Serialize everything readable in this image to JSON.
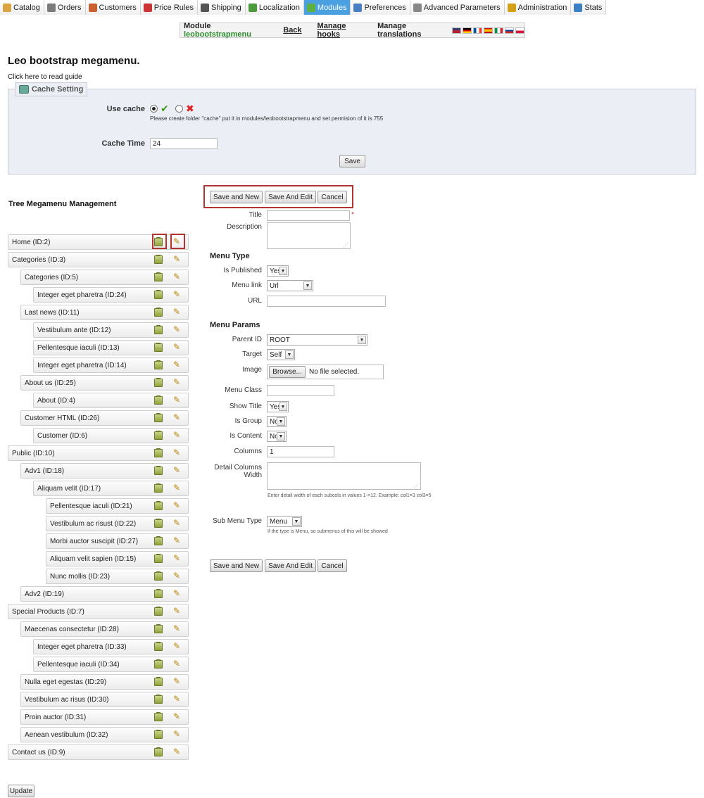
{
  "nav": {
    "tabs": [
      {
        "label": "Catalog",
        "icon": "catalog-icon",
        "color": "#d9a441"
      },
      {
        "label": "Orders",
        "icon": "cart-icon",
        "color": "#7a7a7a"
      },
      {
        "label": "Customers",
        "icon": "customers-icon",
        "color": "#c9602f"
      },
      {
        "label": "Price Rules",
        "icon": "price-rules-icon",
        "color": "#c33"
      },
      {
        "label": "Shipping",
        "icon": "truck-icon",
        "color": "#555"
      },
      {
        "label": "Localization",
        "icon": "globe-icon",
        "color": "#4a9c3b"
      },
      {
        "label": "Modules",
        "icon": "puzzle-icon",
        "color": "#5fb043"
      },
      {
        "label": "Preferences",
        "icon": "preferences-icon",
        "color": "#4a7fc1"
      },
      {
        "label": "Advanced Parameters",
        "icon": "wrench-icon",
        "color": "#888"
      },
      {
        "label": "Administration",
        "icon": "key-icon",
        "color": "#d4a017"
      },
      {
        "label": "Stats",
        "icon": "stats-icon",
        "color": "#3b7fc4"
      }
    ],
    "active": "Modules"
  },
  "module_bar": {
    "prefix": "Module",
    "name": "leobootstrapmenu",
    "back": "Back",
    "manage_hooks": "Manage hooks",
    "manage_translations": "Manage translations",
    "flags": [
      "en",
      "de",
      "fr",
      "es",
      "it",
      "ru",
      "pl"
    ]
  },
  "page": {
    "title": "Leo bootstrap megamenu.",
    "guide_link": "Click here to read guide"
  },
  "cache": {
    "legend": "Cache Setting",
    "use_cache_label": "Use cache",
    "use_cache_value": "yes",
    "note": "Please create folder \"cache\" put it in modules/leobootstrapmenu and set permision of it is 755",
    "cache_time_label": "Cache Time",
    "cache_time_value": "24",
    "save": "Save"
  },
  "tree": {
    "title": "Tree Megamenu Management",
    "update": "Update",
    "nodes": [
      {
        "label": "Home (ID:2)",
        "level": 0
      },
      {
        "label": "Categories (ID:3)",
        "level": 0
      },
      {
        "label": "Categories (ID:5)",
        "level": 1
      },
      {
        "label": "Integer eget pharetra (ID:24)",
        "level": 2
      },
      {
        "label": "Last news (ID:11)",
        "level": 1
      },
      {
        "label": "Vestibulum ante (ID:12)",
        "level": 2
      },
      {
        "label": "Pellentesque iaculi (ID:13)",
        "level": 2
      },
      {
        "label": "Integer eget pharetra (ID:14)",
        "level": 2
      },
      {
        "label": "About us (ID:25)",
        "level": 1
      },
      {
        "label": "About (ID:4)",
        "level": 2
      },
      {
        "label": "Customer HTML (ID:26)",
        "level": 1
      },
      {
        "label": "Customer (ID:6)",
        "level": 2
      },
      {
        "label": "Public (ID:10)",
        "level": 0
      },
      {
        "label": "Adv1 (ID:18)",
        "level": 1
      },
      {
        "label": "Aliquam velit (ID:17)",
        "level": 2
      },
      {
        "label": "Pellentesque iaculi (ID:21)",
        "level": 3
      },
      {
        "label": "Vestibulum ac risust (ID:22)",
        "level": 3
      },
      {
        "label": "Morbi auctor suscipit (ID:27)",
        "level": 3
      },
      {
        "label": "Aliquam velit sapien (ID:15)",
        "level": 3
      },
      {
        "label": "Nunc mollis (ID:23)",
        "level": 3
      },
      {
        "label": "Adv2 (ID:19)",
        "level": 1
      },
      {
        "label": "Special Products (ID:7)",
        "level": 0
      },
      {
        "label": "Maecenas consectetur (ID:28)",
        "level": 1
      },
      {
        "label": "Integer eget pharetra (ID:33)",
        "level": 2
      },
      {
        "label": "Pellentesque iaculi (ID:34)",
        "level": 2
      },
      {
        "label": "Nulla eget egestas (ID:29)",
        "level": 1
      },
      {
        "label": "Vestibulum ac risus (ID:30)",
        "level": 1
      },
      {
        "label": "Proin auctor (ID:31)",
        "level": 1
      },
      {
        "label": "Aenean vestibulum (ID:32)",
        "level": 1
      },
      {
        "label": "Contact us (ID:9)",
        "level": 0
      }
    ]
  },
  "form": {
    "buttons": {
      "save_new": "Save and New",
      "save_edit": "Save And Edit",
      "cancel": "Cancel"
    },
    "title_label": "Title",
    "title_value": "",
    "description_label": "Description",
    "menu_type_heading": "Menu Type",
    "is_published_label": "Is Published",
    "is_published_value": "Yes",
    "menu_link_label": "Menu link",
    "menu_link_value": "Url",
    "url_label": "URL",
    "url_value": "",
    "menu_params_heading": "Menu Params",
    "parent_id_label": "Parent ID",
    "parent_id_value": "ROOT",
    "target_label": "Target",
    "target_value": "Self",
    "image_label": "Image",
    "browse_label": "Browse...",
    "no_file": "No file selected.",
    "menu_class_label": "Menu Class",
    "menu_class_value": "",
    "show_title_label": "Show Title",
    "show_title_value": "Yes",
    "is_group_label": "Is Group",
    "is_group_value": "No",
    "is_content_label": "Is Content",
    "is_content_value": "No",
    "columns_label": "Columns",
    "columns_value": "1",
    "detail_columns_label_1": "Detail Columns",
    "detail_columns_label_2": "Width",
    "detail_hint": "Enter detail width of each subcols in values 1->12. Example: col1=3 col3=5",
    "sub_menu_type_label": "Sub Menu Type",
    "sub_menu_type_value": "Menu",
    "sub_menu_hint": "If the type is Menu, so submenus of this will be showed"
  }
}
